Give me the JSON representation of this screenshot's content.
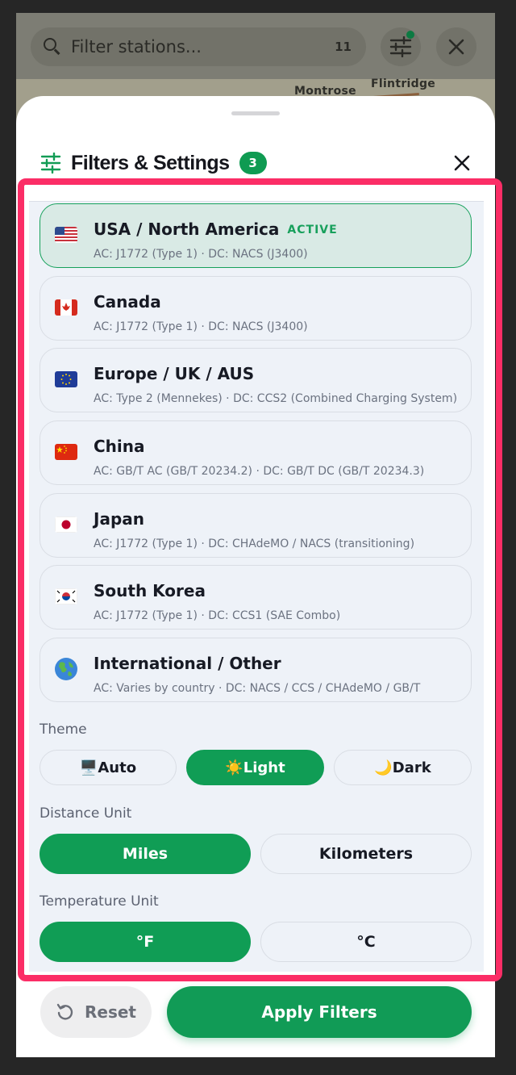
{
  "search": {
    "placeholder": "Filter stations...",
    "count": "11"
  },
  "map": {
    "labels": [
      "Flintridge",
      "Montrose"
    ]
  },
  "sheet": {
    "title": "Filters & Settings",
    "badge_count": "3"
  },
  "regions": [
    {
      "name": "USA / North America",
      "active_label": "ACTIVE",
      "active": true,
      "standards": "AC: J1772 (Type 1) · DC: NACS (J3400)",
      "flag": "us-flag-icon"
    },
    {
      "name": "Canada",
      "active": false,
      "standards": "AC: J1772 (Type 1) · DC: NACS (J3400)",
      "flag": "canada-flag-icon"
    },
    {
      "name": "Europe / UK / AUS",
      "active": false,
      "standards": "AC: Type 2 (Mennekes) · DC: CCS2 (Combined Charging System)",
      "flag": "eu-flag-icon"
    },
    {
      "name": "China",
      "active": false,
      "standards": "AC: GB/T AC (GB/T 20234.2) · DC: GB/T DC (GB/T 20234.3)",
      "flag": "china-flag-icon"
    },
    {
      "name": "Japan",
      "active": false,
      "standards": "AC: J1772 (Type 1) · DC: CHAdeMO / NACS (transitioning)",
      "flag": "japan-flag-icon"
    },
    {
      "name": "South Korea",
      "active": false,
      "standards": "AC: J1772 (Type 1) · DC: CCS1 (SAE Combo)",
      "flag": "korea-flag-icon"
    },
    {
      "name": "International / Other",
      "active": false,
      "standards": "AC: Varies by country · DC: NACS / CCS / CHAdeMO / GB/T",
      "flag": "globe-icon"
    }
  ],
  "theme": {
    "label": "Theme",
    "options": [
      {
        "icon": "🖥️",
        "label": "Auto",
        "selected": false
      },
      {
        "icon": "☀️",
        "label": "Light",
        "selected": true
      },
      {
        "icon": "🌙",
        "label": "Dark",
        "selected": false
      }
    ]
  },
  "distance": {
    "label": "Distance Unit",
    "options": [
      {
        "label": "Miles",
        "selected": true
      },
      {
        "label": "Kilometers",
        "selected": false
      }
    ]
  },
  "temperature": {
    "label": "Temperature Unit",
    "options": [
      {
        "label": "°F",
        "selected": true
      },
      {
        "label": "°C",
        "selected": false
      }
    ]
  },
  "footer": {
    "reset_label": "Reset",
    "apply_label": "Apply Filters"
  },
  "colors": {
    "accent": "#109d55",
    "highlight": "#fb2d66"
  }
}
